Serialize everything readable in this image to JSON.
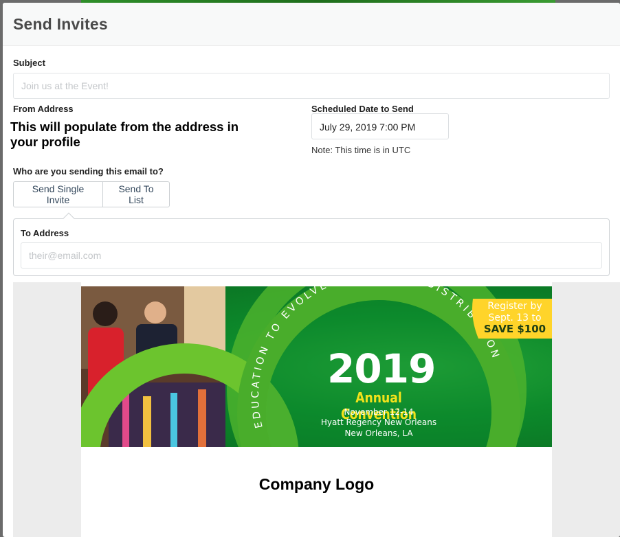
{
  "modal": {
    "title": "Send Invites"
  },
  "subject": {
    "label": "Subject",
    "placeholder": "Join us at the Event!"
  },
  "from": {
    "label": "From Address",
    "note": "This will populate from the address in your profile"
  },
  "schedule": {
    "label": "Scheduled Date to Send",
    "value": "July 29, 2019 7:00 PM",
    "note": "Note: This time is in UTC"
  },
  "recipients": {
    "question": "Who are you sending this email to?",
    "single_label": "Send Single Invite",
    "list_label": "Send To List"
  },
  "to_address": {
    "label": "To Address",
    "placeholder": "their@email.com"
  },
  "banner": {
    "arc_text": "EDUCATION TO EVOLVE PROFITABLE DISTRIBUTION",
    "year": "2019",
    "event_name": "Annual Convention",
    "dates": "November 12-14",
    "venue": "Hyatt Regency New Orleans",
    "city": "New Orleans, LA",
    "promo_line1": "Register by",
    "promo_line2": "Sept. 13 to",
    "promo_line3": "SAVE $100"
  },
  "company_logo": "Company Logo",
  "colors": {
    "banner_green": "#0d8a2b",
    "ring_green": "#4cb12d",
    "event_yellow": "#f2e21b",
    "promo_yellow": "#ffd42a"
  }
}
